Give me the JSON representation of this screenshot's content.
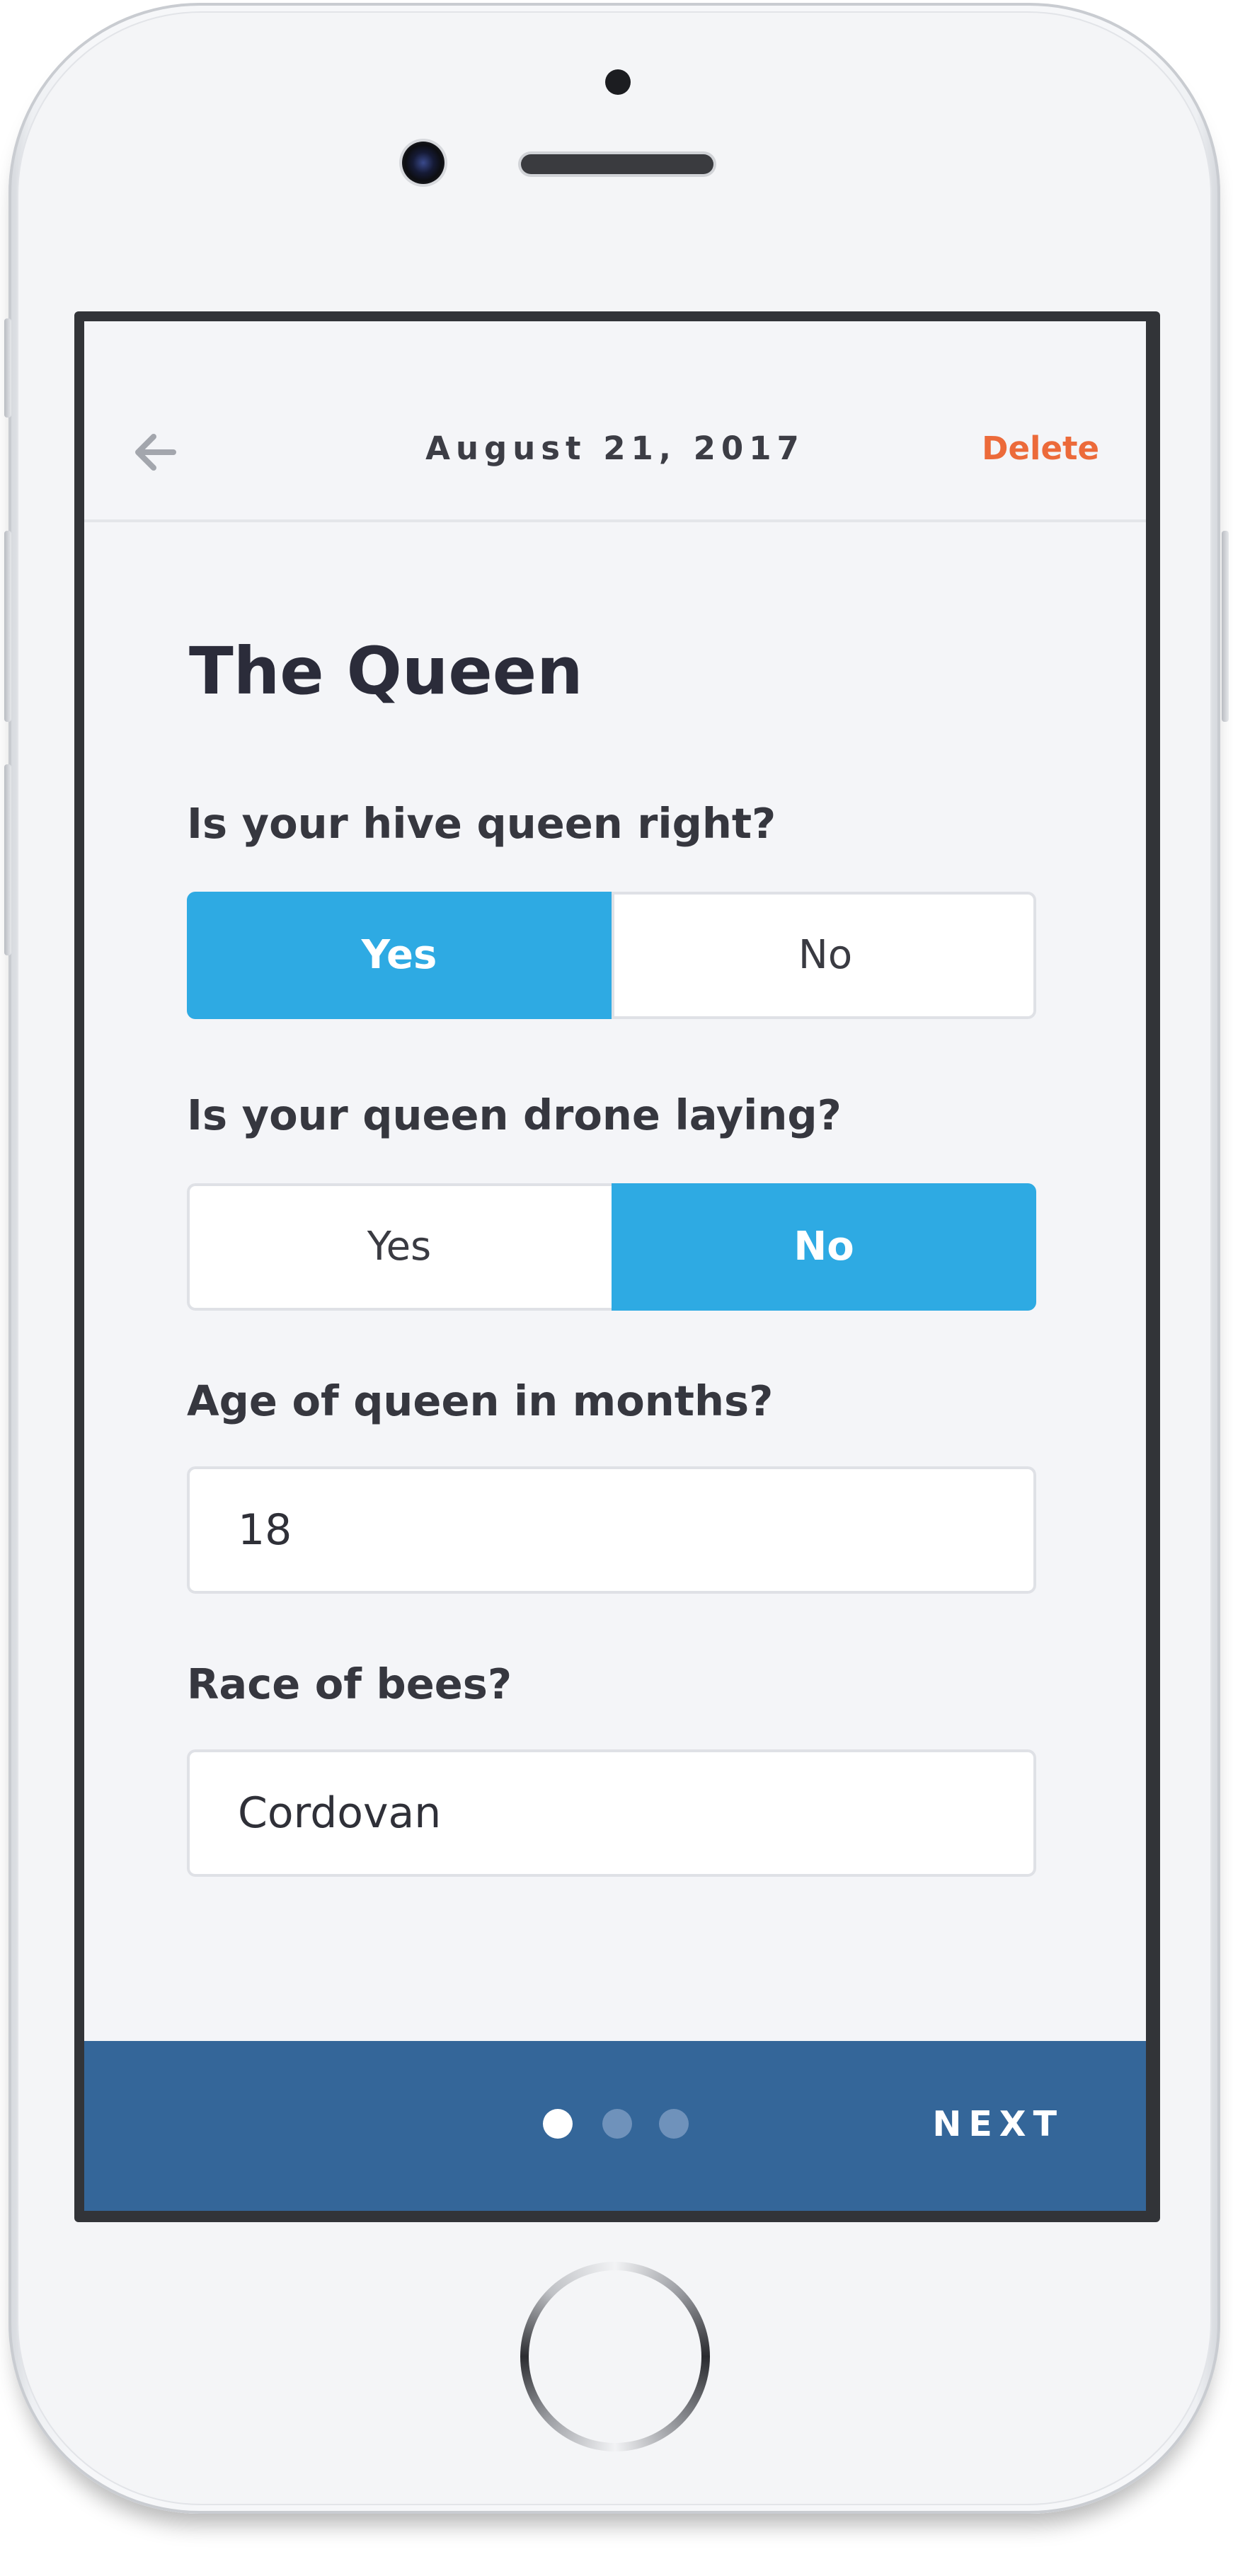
{
  "header": {
    "back_icon": "arrow-left-icon",
    "date": "August 21, 2017",
    "delete_label": "Delete"
  },
  "section": {
    "title": "The Queen"
  },
  "questions": [
    {
      "label": "Is your hive queen right?",
      "options": [
        "Yes",
        "No"
      ],
      "selected": "Yes"
    },
    {
      "label": "Is your queen drone laying?",
      "options": [
        "Yes",
        "No"
      ],
      "selected": "No"
    }
  ],
  "fields": [
    {
      "label": "Age of queen in months?",
      "value": "18"
    },
    {
      "label": "Race of bees?",
      "value": "Cordovan"
    }
  ],
  "footer": {
    "pages": 3,
    "current_page": 1,
    "next_label": "NEXT"
  },
  "colors": {
    "accent": "#2eaae3",
    "delete": "#ec6a3a",
    "footer_bg": "#346699",
    "background": "#f4f5f8"
  }
}
